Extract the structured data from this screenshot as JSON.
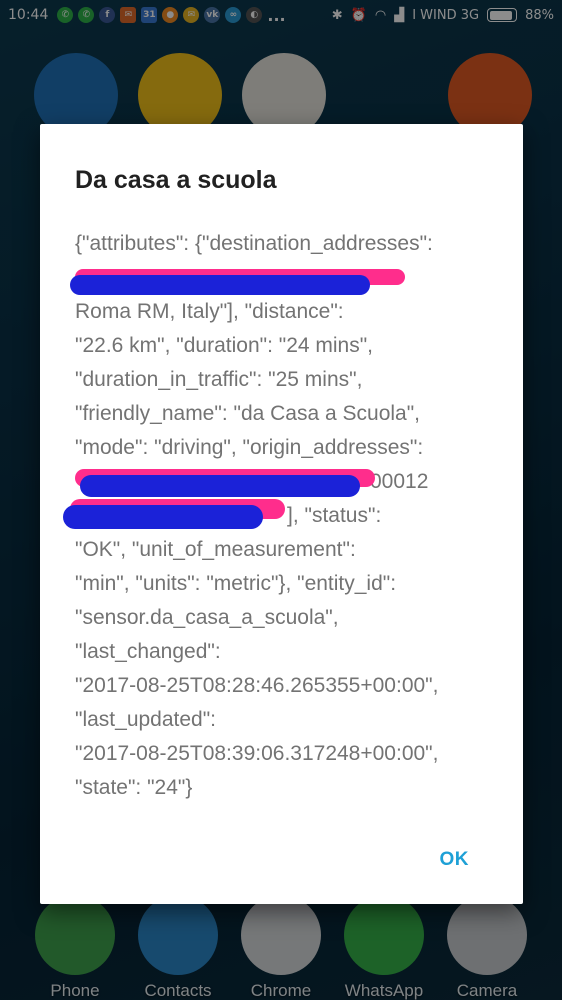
{
  "status_bar": {
    "time": "10:44",
    "carrier": "I WIND 3G",
    "battery": "88%",
    "battery_level": 0.88,
    "notification_icons": [
      "whatsapp-icon",
      "whatsapp-icon",
      "facebook-icon",
      "mail-icon",
      "calendar-icon",
      "app-icon",
      "mail-icon",
      "vk-icon",
      "app-icon",
      "app-icon"
    ],
    "more": "..."
  },
  "dock": {
    "apps": [
      {
        "name": "phone",
        "label": "Phone",
        "color": "#3fa34d"
      },
      {
        "name": "contacts",
        "label": "Contacts",
        "color": "#2b88c9"
      },
      {
        "name": "chrome",
        "label": "Chrome",
        "color": "#d7dbdd"
      },
      {
        "name": "whatsapp",
        "label": "WhatsApp",
        "color": "#35b34a"
      },
      {
        "name": "camera",
        "label": "Camera",
        "color": "#c8cdd0"
      }
    ]
  },
  "dialog": {
    "title": "Da casa a scuola",
    "lines": [
      "{\"attributes\": {\"destination_addresses\":",
      "",
      "Roma RM, Italy\"], \"distance\":",
      "\"22.6 km\", \"duration\": \"24 mins\",",
      "\"duration_in_traffic\": \"25 mins\",",
      "\"friendly_name\": \"da Casa a Scuola\",",
      "\"mode\": \"driving\", \"origin_addresses\":",
      "00012",
      "], \"status\":",
      "\"OK\", \"unit_of_measurement\":",
      "\"min\", \"units\": \"metric\"}, \"entity_id\":",
      "\"sensor.da_casa_a_scuola\",",
      "\"last_changed\":",
      "\"2017-08-25T08:28:46.265355+00:00\",",
      "\"last_updated\":",
      "\"2017-08-25T08:39:06.317248+00:00\",",
      "\"state\": \"24\"}"
    ],
    "ok_label": "OK"
  }
}
